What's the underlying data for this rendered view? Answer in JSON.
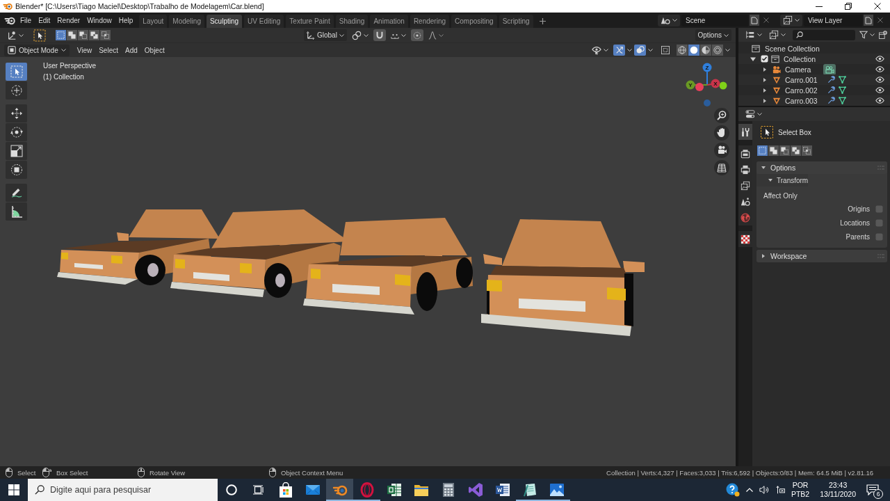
{
  "window": {
    "title": "Blender* [C:\\Users\\Tiago Maciel\\Desktop\\Trabalho de Modelagem\\Car.blend]"
  },
  "menu": [
    "File",
    "Edit",
    "Render",
    "Window",
    "Help"
  ],
  "workspaces": [
    {
      "label": "Layout",
      "selected": false
    },
    {
      "label": "Modeling",
      "selected": false
    },
    {
      "label": "Sculpting",
      "selected": true
    },
    {
      "label": "UV Editing",
      "selected": false
    },
    {
      "label": "Texture Paint",
      "selected": false
    },
    {
      "label": "Shading",
      "selected": false
    },
    {
      "label": "Animation",
      "selected": false
    },
    {
      "label": "Rendering",
      "selected": false
    },
    {
      "label": "Compositing",
      "selected": false
    },
    {
      "label": "Scripting",
      "selected": false
    }
  ],
  "scene": {
    "value": "Scene"
  },
  "view_layer": {
    "value": "View Layer"
  },
  "tool_header": {
    "selection_modes": [
      {
        "kind": "set",
        "selected": true
      },
      {
        "kind": "extend",
        "selected": false
      },
      {
        "kind": "subtract",
        "selected": false
      },
      {
        "kind": "invert",
        "selected": false
      },
      {
        "kind": "intersect",
        "selected": false
      }
    ],
    "orientation": "Global",
    "snap": false,
    "proportional_editing": false,
    "options": "Options"
  },
  "view_header": {
    "mode": "Object Mode",
    "menus": [
      "View",
      "Select",
      "Add",
      "Object"
    ],
    "gizmos": true,
    "overlays": true,
    "xray": false,
    "shading": [
      {
        "kind": "wireframe",
        "selected": false
      },
      {
        "kind": "solid",
        "selected": true
      },
      {
        "kind": "material",
        "selected": false
      },
      {
        "kind": "rendered",
        "selected": false
      }
    ]
  },
  "viewport": {
    "info": [
      "User Perspective",
      "(1) Collection"
    ],
    "tool_groups": [
      [
        {
          "kind": "select_box",
          "selected": true
        },
        {
          "kind": "cursor",
          "selected": false
        }
      ],
      [
        {
          "kind": "move",
          "selected": false
        },
        {
          "kind": "rotate",
          "selected": false
        },
        {
          "kind": "scale",
          "selected": false
        },
        {
          "kind": "transform",
          "selected": false
        }
      ],
      [
        {
          "kind": "annotate",
          "selected": false
        },
        {
          "kind": "measure",
          "selected": false
        }
      ]
    ],
    "gizmo_axes": [
      {
        "label": "Z",
        "color": "#2f7fdc"
      },
      {
        "label": "Y",
        "color": "#6a9a24"
      },
      {
        "label": "X",
        "color": "#c8344a"
      }
    ],
    "navigation": [
      {
        "kind": "zoom"
      },
      {
        "kind": "pan"
      },
      {
        "kind": "camera"
      },
      {
        "kind": "ortho"
      }
    ]
  },
  "outliner": {
    "root": "Scene Collection",
    "items": [
      {
        "label": "Collection",
        "kind": "collection",
        "expanded": true,
        "checked": true,
        "visible": true,
        "children": [
          {
            "label": "Camera",
            "kind": "camera",
            "expanded": false,
            "visible": true
          },
          {
            "label": "Carro.001",
            "kind": "mesh",
            "expanded": false,
            "visible": true
          },
          {
            "label": "Carro.002",
            "kind": "mesh",
            "expanded": false,
            "visible": true
          },
          {
            "label": "Carro.003",
            "kind": "mesh",
            "expanded": false,
            "visible": true
          }
        ]
      }
    ]
  },
  "properties": {
    "tab_groups": [
      [
        {
          "kind": "tool",
          "selected": true
        }
      ],
      [
        {
          "kind": "render",
          "selected": false
        },
        {
          "kind": "output",
          "selected": false
        },
        {
          "kind": "view_layer",
          "selected": false
        },
        {
          "kind": "scene",
          "selected": false
        },
        {
          "kind": "world",
          "selected": false
        }
      ],
      [
        {
          "kind": "texture",
          "selected": false
        }
      ]
    ],
    "tool": "Select Box",
    "selection_modes": [
      {
        "kind": "set",
        "selected": true
      },
      {
        "kind": "extend",
        "selected": false
      },
      {
        "kind": "subtract",
        "selected": false
      },
      {
        "kind": "invert",
        "selected": false
      },
      {
        "kind": "intersect",
        "selected": false
      }
    ],
    "panels": [
      {
        "label": "Options",
        "expanded": true,
        "subpanels": [
          {
            "label": "Transform",
            "expanded": true,
            "heading": "Affect Only",
            "checkboxes": [
              {
                "label": "Origins",
                "checked": false
              },
              {
                "label": "Locations",
                "checked": false
              },
              {
                "label": "Parents",
                "checked": false
              }
            ]
          }
        ]
      },
      {
        "label": "Workspace",
        "expanded": false
      }
    ]
  },
  "status_bar": {
    "hints": [
      {
        "label": "Select",
        "kind": "left_click"
      },
      {
        "label": "Box Select",
        "kind": "left_drag"
      },
      {
        "label": "Rotate View",
        "kind": "middle_drag"
      },
      {
        "label": "Object Context Menu",
        "kind": "right_click"
      }
    ],
    "stats": "Collection | Verts:4,327 | Faces:3,033 | Tris:6,592 | Objects:0/83 | Mem: 64.5 MiB | v2.81.16"
  },
  "taskbar": {
    "search": {
      "placeholder": "Digite aqui para pesquisar"
    },
    "apps": [
      {
        "kind": "shopping_bag",
        "selected": false,
        "running": false
      },
      {
        "kind": "envelope",
        "selected": false,
        "running": false
      },
      {
        "kind": "blender",
        "selected": true,
        "running": true
      },
      {
        "kind": "ring",
        "selected": false,
        "running": true
      },
      {
        "kind": "spreadsheet",
        "selected": false,
        "running": false
      },
      {
        "kind": "folder",
        "selected": false,
        "running": false
      },
      {
        "kind": "calculator",
        "selected": false,
        "running": false
      },
      {
        "kind": "ribbon",
        "selected": false,
        "running": false
      },
      {
        "kind": "document",
        "selected": false,
        "running": false
      },
      {
        "kind": "notepad",
        "selected": false,
        "running": true
      },
      {
        "kind": "photo",
        "selected": false,
        "running": true
      }
    ],
    "language": [
      "POR",
      "PTB2"
    ],
    "time": "23:43",
    "date": "13/11/2020",
    "notifications": "6"
  }
}
